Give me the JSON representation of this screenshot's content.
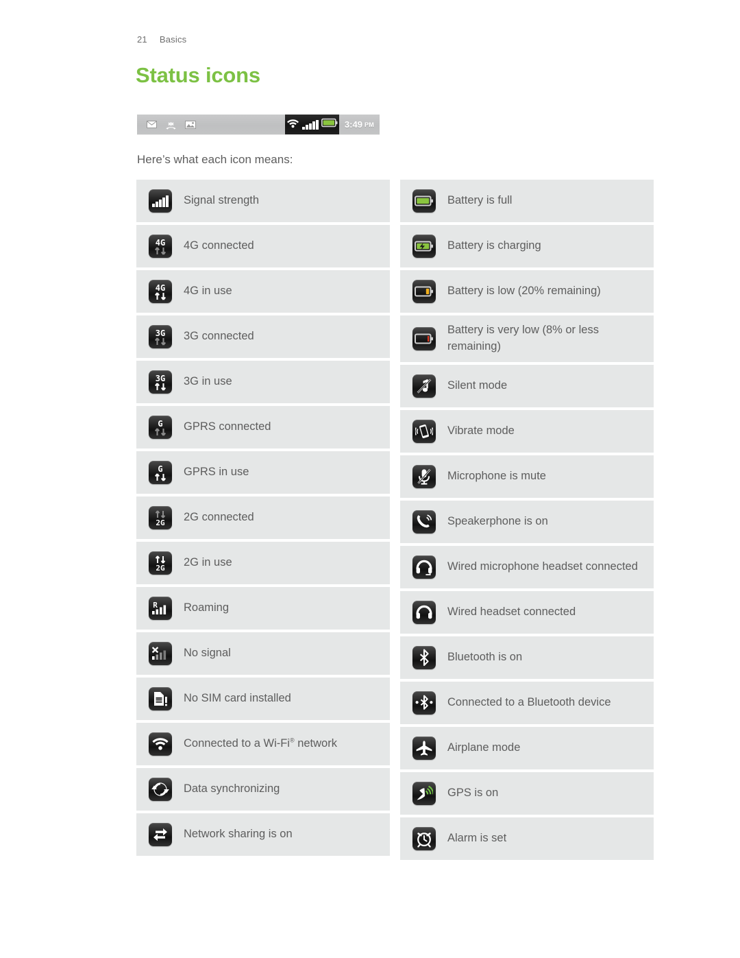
{
  "header": {
    "page_number": "21",
    "section": "Basics"
  },
  "title": "Status icons",
  "statusbar": {
    "left_icons": [
      "mail-icon",
      "missed-call-icon",
      "screenshot-icon"
    ],
    "dark_icons": [
      "wifi-icon",
      "signal-icon",
      "battery-icon"
    ],
    "time": "3:49",
    "meridiem": "PM"
  },
  "intro": "Here’s what each icon means:",
  "colors": {
    "heading_green": "#7cc144",
    "row_bg": "#e5e7e7",
    "text": "#5d5d5d",
    "battery_full_green": "#8ac43f",
    "battery_low_yellow": "#f2b01e",
    "battery_verylow_red": "#e03a22",
    "gps_green": "#6fbe44"
  },
  "left_column": [
    {
      "icon": "signal-strength-icon",
      "label": "Signal strength"
    },
    {
      "icon": "4g-connected-icon",
      "label": "4G connected"
    },
    {
      "icon": "4g-in-use-icon",
      "label": "4G in use"
    },
    {
      "icon": "3g-connected-icon",
      "label": "3G connected"
    },
    {
      "icon": "3g-in-use-icon",
      "label": "3G in use"
    },
    {
      "icon": "gprs-connected-icon",
      "label": "GPRS connected"
    },
    {
      "icon": "gprs-in-use-icon",
      "label": "GPRS in use"
    },
    {
      "icon": "2g-connected-icon",
      "label": "2G connected"
    },
    {
      "icon": "2g-in-use-icon",
      "label": "2G in use"
    },
    {
      "icon": "roaming-icon",
      "label": "Roaming"
    },
    {
      "icon": "no-signal-icon",
      "label": "No signal"
    },
    {
      "icon": "no-sim-card-icon",
      "label": "No SIM card installed"
    },
    {
      "icon": "wifi-connected-icon",
      "label": "Connected to a Wi-Fi",
      "sup": "®",
      "label_tail": " network"
    },
    {
      "icon": "data-sync-icon",
      "label": "Data synchronizing"
    },
    {
      "icon": "network-sharing-icon",
      "label": "Network sharing is on"
    }
  ],
  "right_column": [
    {
      "icon": "battery-full-icon",
      "label": "Battery is full"
    },
    {
      "icon": "battery-charging-icon",
      "label": "Battery is charging"
    },
    {
      "icon": "battery-low-icon",
      "label": "Battery is low (20% remaining)"
    },
    {
      "icon": "battery-very-low-icon",
      "label": "Battery is very low (8% or less remaining)"
    },
    {
      "icon": "silent-mode-icon",
      "label": "Silent mode"
    },
    {
      "icon": "vibrate-mode-icon",
      "label": "Vibrate mode"
    },
    {
      "icon": "microphone-mute-icon",
      "label": "Microphone is mute"
    },
    {
      "icon": "speakerphone-icon",
      "label": "Speakerphone is on"
    },
    {
      "icon": "wired-mic-headset-icon",
      "label": "Wired microphone headset connected"
    },
    {
      "icon": "wired-headset-icon",
      "label": "Wired headset connected"
    },
    {
      "icon": "bluetooth-on-icon",
      "label": "Bluetooth is on"
    },
    {
      "icon": "bluetooth-connected-icon",
      "label": "Connected to a Bluetooth device"
    },
    {
      "icon": "airplane-mode-icon",
      "label": "Airplane mode"
    },
    {
      "icon": "gps-on-icon",
      "label": "GPS is on"
    },
    {
      "icon": "alarm-set-icon",
      "label": "Alarm is set"
    }
  ]
}
